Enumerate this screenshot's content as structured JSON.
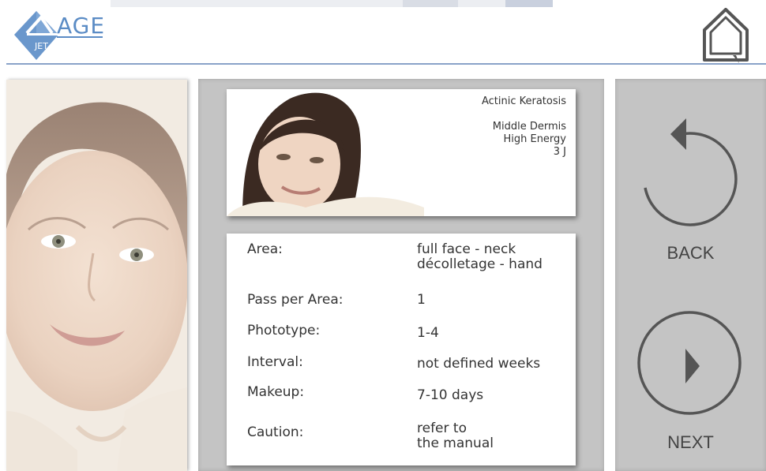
{
  "app": {
    "logo_text": "AGE",
    "logo_sub": "JET"
  },
  "header": {
    "home_icon": "home-icon"
  },
  "preview": {
    "indication": "Actinic Keratosis",
    "depth": "Middle Dermis",
    "energy_level": "High Energy",
    "energy_value": "3 J"
  },
  "details": {
    "rows": [
      {
        "label": "Area:",
        "value_line1": "full face - neck",
        "value_line2": "décolletage - hand"
      },
      {
        "label": "Pass per Area:",
        "value_line1": "1",
        "value_line2": ""
      },
      {
        "label": "Phototype:",
        "value_line1": "1-4",
        "value_line2": ""
      },
      {
        "label": "Interval:",
        "value_line1": "not defined weeks",
        "value_line2": ""
      },
      {
        "label": "Makeup:",
        "value_line1": "7-10 days",
        "value_line2": ""
      },
      {
        "label": "Caution:",
        "value_line1": "refer to",
        "value_line2": "the manual"
      }
    ]
  },
  "nav": {
    "back_label": "BACK",
    "back_icon": "back-arrow-icon",
    "next_label": "NEXT",
    "next_icon": "play-next-icon"
  },
  "colors": {
    "accent": "#5b8cc5",
    "panel_gray": "#c4c4c4",
    "icon_gray": "#555555"
  }
}
